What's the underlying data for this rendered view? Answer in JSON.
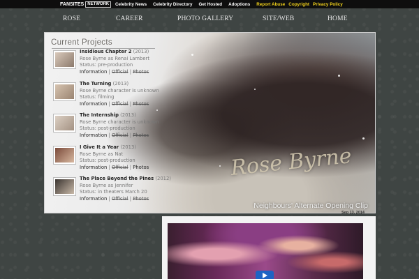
{
  "topbar": {
    "logo": {
      "text": "FANSITES",
      "network": "NETWORK"
    },
    "links": [
      "Celebrity News",
      "Celebrity Directory",
      "Get Hosted",
      "Adoptions"
    ],
    "highlight_links": [
      "Report Abuse",
      "Copyright",
      "Privacy Policy"
    ]
  },
  "nav": [
    "ROSE",
    "CAREER",
    "PHOTO GALLERY",
    "SITE/WEB",
    "HOME"
  ],
  "section_title": "Current Projects",
  "signature": "Rose Byrne",
  "projects": [
    {
      "title": "Insidious Chapter 2",
      "year": "(2013)",
      "line1": "Rose Byrne as Renai Lambert",
      "line2": "Status: pre-production",
      "info": "Information",
      "official": "Official",
      "photos": "Photos"
    },
    {
      "title": "The Turning",
      "year": "(2013)",
      "line1": "Rose Byrne character is unknown",
      "line2": "Status: filming",
      "info": "Information",
      "official": "Official",
      "photos": "Photos"
    },
    {
      "title": "The Internship",
      "year": "(2013)",
      "line1": "Rose Byrne character is unknown",
      "line2": "Status: post-production",
      "info": "Information",
      "official": "Official",
      "photos": "Photos"
    },
    {
      "title": "I Give It a Year",
      "year": "(2013)",
      "line1": "Rose Byrne as Nat",
      "line2": "Status: post-production",
      "info": "Information",
      "official": "Official",
      "photos": "Photos"
    },
    {
      "title": "The Place Beyond the Pines",
      "year": "(2012)",
      "line1": "Rose Byrne as Jennifer",
      "line2": "Status: in theaters March 20",
      "info": "Information",
      "official": "Official",
      "photos": "Photos"
    }
  ],
  "video": {
    "title": "Neighbours' Alternate Opening Clip",
    "date": "Sep 13, 2014"
  },
  "colors": {
    "topbar": "#0e0e0e",
    "highlight": "#f2d21b",
    "play_button": "#1e63c4"
  }
}
